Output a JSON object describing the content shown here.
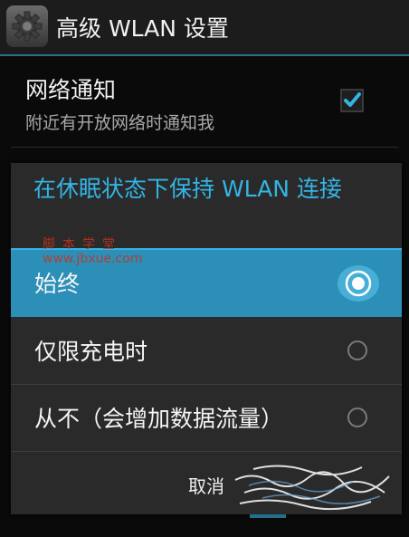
{
  "action_bar": {
    "title": "高级 WLAN 设置",
    "icon": "settings-gear-icon"
  },
  "preference": {
    "title": "网络通知",
    "summary": "附近有开放网络时通知我",
    "checked": true
  },
  "dialog": {
    "title": "在休眠状态下保持 WLAN 连接",
    "options": [
      {
        "label": "始终",
        "selected": true
      },
      {
        "label": "仅限充电时",
        "selected": false
      },
      {
        "label": "从不（会增加数据流量）",
        "selected": false
      }
    ],
    "cancel_label": "取消"
  },
  "watermark": {
    "text_cn": "脚本学堂",
    "text_url": "www.jbxue.com"
  },
  "colors": {
    "accent": "#33b5e5",
    "selected_row": "#2b8fb8",
    "dialog_bg": "#2a2a2a",
    "watermark": "#c8321e"
  }
}
